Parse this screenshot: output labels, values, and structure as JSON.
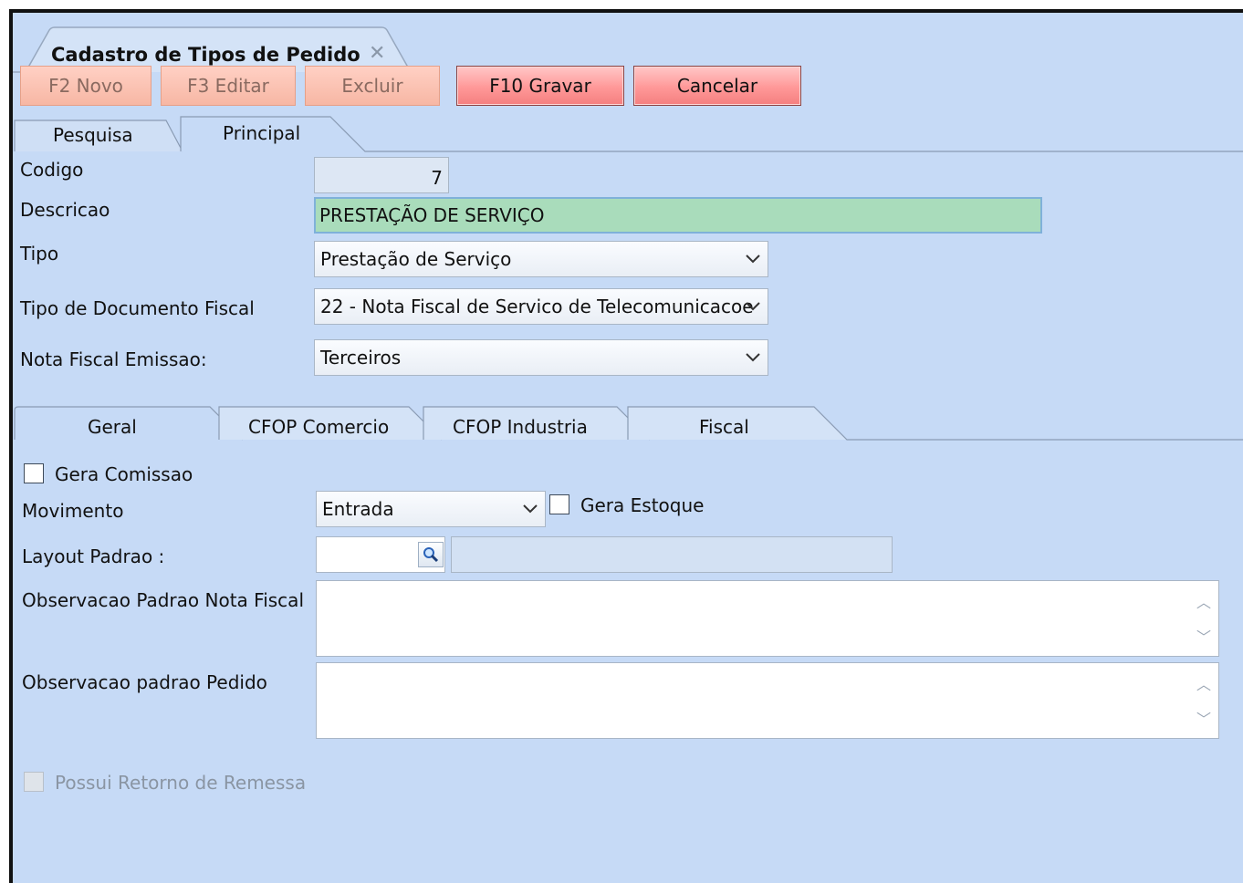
{
  "window": {
    "tab_title": "Cadastro de Tipos de Pedido",
    "close_glyph": "✕"
  },
  "toolbar": {
    "novo": "F2 Novo",
    "editar": "F3 Editar",
    "excluir": "Excluir",
    "gravar": "F10 Gravar",
    "cancelar": "Cancelar"
  },
  "main_tabs": [
    {
      "label": "Pesquisa"
    },
    {
      "label": "Principal",
      "active": true
    }
  ],
  "form": {
    "codigo_label": "Codigo",
    "codigo_value": "7",
    "descricao_label": "Descricao",
    "descricao_value": "PRESTAÇÃO DE SERVIÇO",
    "tipo_label": "Tipo",
    "tipo_value": "Prestação de Serviço",
    "tipo_doc_label": "Tipo de Documento Fiscal",
    "tipo_doc_value": "22 - Nota Fiscal de Servico de Telecomunicacoe",
    "nf_emissao_label": "Nota Fiscal Emissao:",
    "nf_emissao_value": "Terceiros"
  },
  "sub_tabs": [
    {
      "label": "Geral",
      "active": true
    },
    {
      "label": "CFOP Comercio"
    },
    {
      "label": "CFOP Industria"
    },
    {
      "label": "Fiscal"
    }
  ],
  "geral": {
    "gera_comissao_label": "Gera Comissao",
    "gera_comissao_checked": false,
    "movimento_label": "Movimento",
    "movimento_value": "Entrada",
    "gera_estoque_label": "Gera Estoque",
    "gera_estoque_checked": false,
    "layout_label": "Layout Padrao :",
    "layout_value": "",
    "obs_nf_label": "Observacao Padrao Nota Fiscal",
    "obs_nf_value": "",
    "obs_pedido_label": "Observacao padrao Pedido",
    "obs_pedido_value": "",
    "retorno_label": "Possui Retorno de Remessa",
    "retorno_checked": false
  },
  "icons": {
    "dropdown": "chevron-down-icon",
    "lookup": "magnifier-icon",
    "scroll_up": "scroll-up-icon",
    "scroll_down": "scroll-down-icon"
  },
  "colors": {
    "background": "#c6daf6",
    "descricao_highlight": "#a9dcbb",
    "action_button": "#ff9898",
    "disabled_button": "#f7b7a4"
  }
}
